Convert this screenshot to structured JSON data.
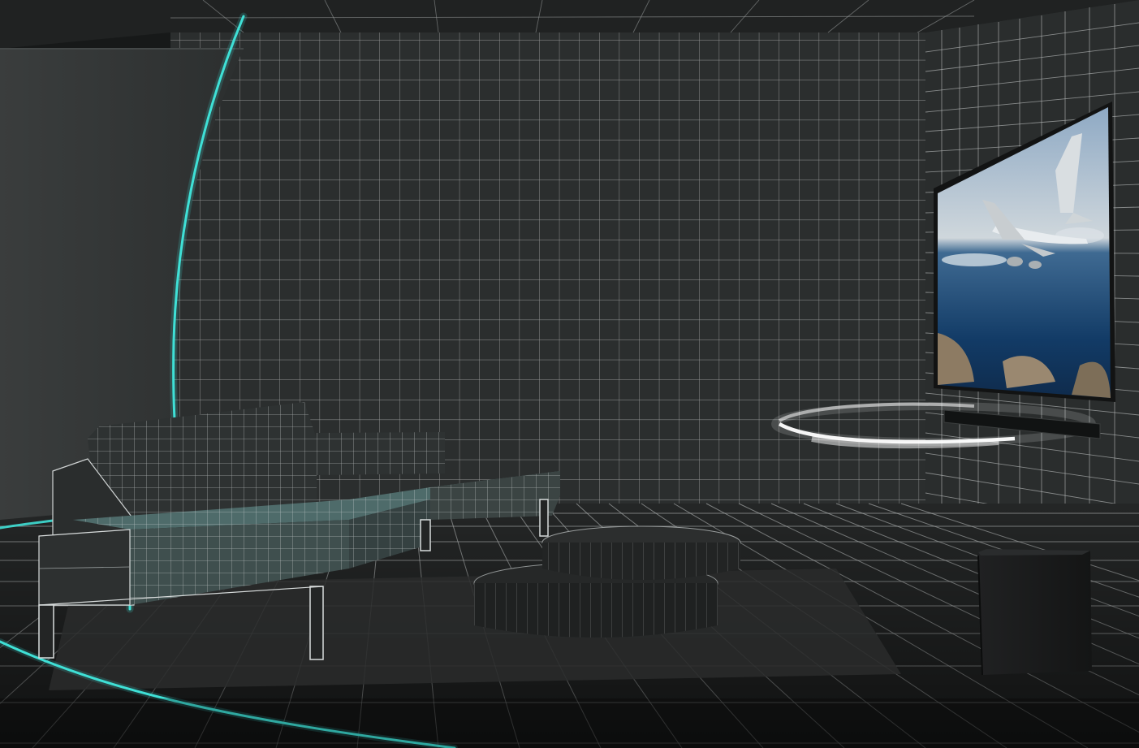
{
  "scene": {
    "room": "grid-wireframe-living-room",
    "colors": {
      "wall": "#2e3131",
      "grid_line": "#b9bcbc",
      "accent_arc": "#3fe0d6",
      "sofa_front_tint": "#6fb6b0",
      "tv_bezel": "#1a1a1a",
      "soundbar": "#111313",
      "subwoofer": "#1b1c1d",
      "floor": "#262828"
    },
    "objects": [
      {
        "name": "sofa",
        "icon": "sofa-wireframe"
      },
      {
        "name": "coffee-table",
        "icon": "round-tiered-table"
      },
      {
        "name": "television",
        "icon": "wall-mounted-tv",
        "screen_content": "airplane-over-coastline"
      },
      {
        "name": "soundbar",
        "icon": "soundbar-with-sound-wave"
      },
      {
        "name": "subwoofer",
        "icon": "subwoofer-box"
      }
    ],
    "effects": [
      {
        "name": "sound-coverage-arc",
        "color": "#3fe0d6"
      },
      {
        "name": "sound-wave-ring",
        "color": "#ffffff"
      }
    ]
  }
}
